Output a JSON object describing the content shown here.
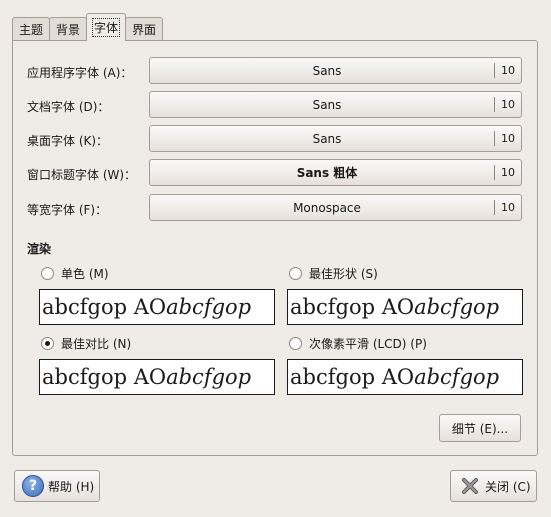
{
  "tabs": [
    {
      "label": "主题"
    },
    {
      "label": "背景"
    },
    {
      "label": "字体"
    },
    {
      "label": "界面"
    }
  ],
  "active_tab": "字体",
  "fonts": [
    {
      "label": "应用程序字体 (A)：",
      "font": "Sans",
      "size": "10",
      "bold": false
    },
    {
      "label": "文档字体 (D)：",
      "font": "Sans",
      "size": "10",
      "bold": false
    },
    {
      "label": "桌面字体 (K)：",
      "font": "Sans",
      "size": "10",
      "bold": false
    },
    {
      "label": "窗口标题字体 (W)：",
      "font": "Sans 粗体",
      "size": "10",
      "bold": true
    },
    {
      "label": "等宽字体 (F)：",
      "font": "Monospace",
      "size": "10",
      "bold": false
    }
  ],
  "rendering": {
    "title": "渲染",
    "options": [
      {
        "label": "单色 (M)",
        "checked": false
      },
      {
        "label": "最佳形状 (S)",
        "checked": false
      },
      {
        "label": "最佳对比 (N)",
        "checked": true
      },
      {
        "label": "次像素平滑 (LCD) (P)",
        "checked": false
      }
    ],
    "preview_text_plain": "abcfgop AO ",
    "preview_text_italic": "abcfgop"
  },
  "details_button": "细节 (E)...",
  "help_button": "帮助 (H)",
  "close_button": "关闭 (C)",
  "icons": {
    "help": "help-icon",
    "close": "close-icon"
  }
}
